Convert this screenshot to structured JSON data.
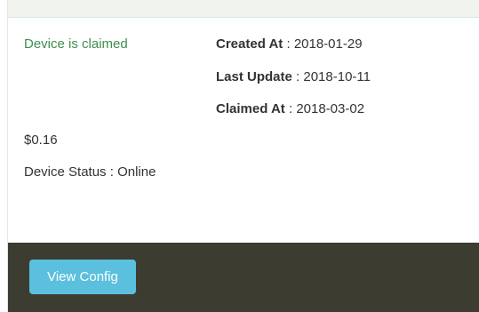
{
  "device": {
    "claimed_status": "Device is claimed",
    "price": "$0.16",
    "status_label": "Device Status",
    "status_value": "Online"
  },
  "meta": {
    "created_label": "Created At",
    "created_value": "2018-01-29",
    "updated_label": "Last Update",
    "updated_value": "2018-10-11",
    "claimed_label": "Claimed At",
    "claimed_value": "2018-03-02",
    "separator": " : "
  },
  "actions": {
    "view_config_label": "View Config"
  },
  "colors": {
    "header_bg": "#f1f3ee",
    "claimed_text": "#3e8e4f",
    "footer_bg": "#3c3d30",
    "button_bg": "#5bc0de"
  }
}
